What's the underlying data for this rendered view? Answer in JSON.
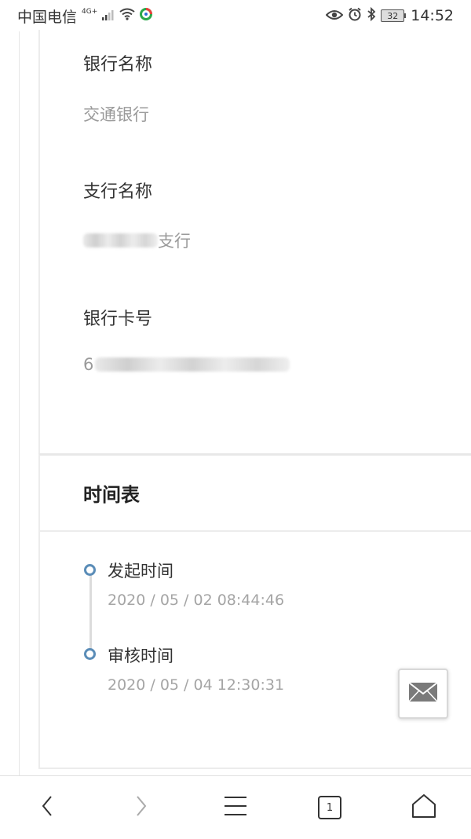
{
  "status_bar": {
    "carrier": "中国电信",
    "network": "4G+",
    "battery": "32",
    "time": "14:52"
  },
  "bank": {
    "bank_name_label": "银行名称",
    "bank_name_value": "交通银行",
    "branch_label": "支行名称",
    "branch_value_visible": "支行",
    "card_label": "银行卡号",
    "card_value_visible": "6"
  },
  "timetable": {
    "title": "时间表",
    "events": [
      {
        "label": "发起时间",
        "time": "2020 / 05 / 02 08:44:46"
      },
      {
        "label": "审核时间",
        "time": "2020 / 05 / 04 12:30:31"
      }
    ]
  },
  "navbar": {
    "tab_count": "1",
    "items": [
      "back-icon",
      "forward-icon",
      "menu-icon",
      "tabs-icon",
      "home-icon"
    ]
  },
  "colors": {
    "accent": "#5b8db8"
  }
}
